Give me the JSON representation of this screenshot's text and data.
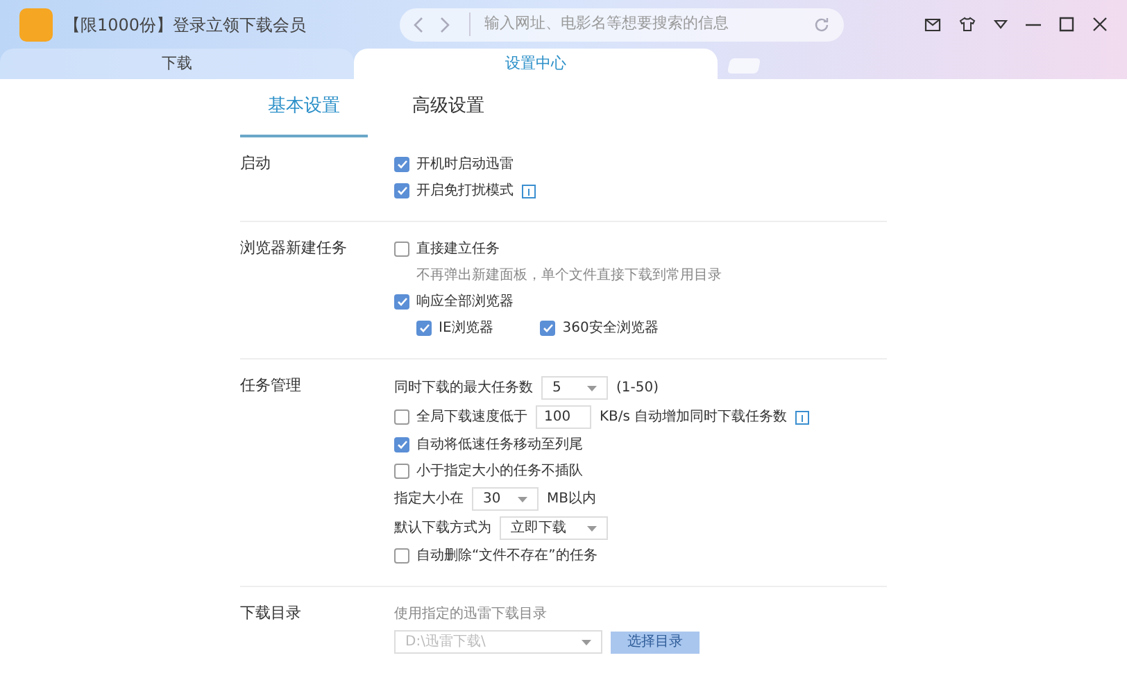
{
  "window": {
    "title": "【限1000份】登录立领下载会员",
    "search": {
      "placeholder": "输入网址、电影名等想要搜索的信息"
    }
  },
  "tabs": [
    {
      "label": "下载",
      "selected": false
    },
    {
      "label": "设置中心",
      "selected": true
    }
  ],
  "subtabs": [
    {
      "label": "基本设置",
      "selected": true
    },
    {
      "label": "高级设置",
      "selected": false
    }
  ],
  "sections": [
    {
      "title": "启动",
      "rows": [
        {
          "kind": "checkbox",
          "checked": true,
          "label": "开机时启动迅雷"
        },
        {
          "kind": "checkbox",
          "checked": true,
          "label": "开启免打扰模式",
          "info": true
        }
      ]
    },
    {
      "title": "浏览器新建任务",
      "rows": [
        {
          "kind": "checkbox",
          "checked": false,
          "label": "直接建立任务"
        },
        {
          "kind": "hint",
          "text": "不再弹出新建面板，单个文件直接下载到常用目录"
        },
        {
          "kind": "checkbox",
          "checked": true,
          "label": "响应全部浏览器"
        },
        {
          "kind": "group",
          "items": [
            {
              "checked": true,
              "label": "IE浏览器"
            },
            {
              "checked": true,
              "label": "360安全浏览器"
            }
          ]
        }
      ]
    },
    {
      "title": "任务管理",
      "rows": [
        {
          "kind": "select",
          "label": "同时下载的最大任务数",
          "value": "5",
          "suffix": "(1-50)"
        },
        {
          "kind": "checkbox_input",
          "checked": false,
          "label": "全局下载速度低于",
          "value": "100",
          "suffix": "KB/s 自动增加同时下载任务数",
          "info": true
        },
        {
          "kind": "checkbox",
          "checked": true,
          "label": "自动将低速任务移动至列尾"
        },
        {
          "kind": "checkbox",
          "checked": false,
          "label": "小于指定大小的任务不插队"
        },
        {
          "kind": "select",
          "label": "指定大小在",
          "value": "30",
          "suffix": "MB以内"
        },
        {
          "kind": "select",
          "label": "默认下载方式为",
          "value": "立即下载"
        },
        {
          "kind": "checkbox",
          "checked": false,
          "label": "自动删除“文件不存在”的任务"
        }
      ]
    },
    {
      "title": "下载目录",
      "rows": [
        {
          "kind": "hint",
          "text": "使用指定的迅雷下载目录"
        },
        {
          "kind": "path",
          "value": "D:\\迅雷下载\\",
          "button": "选择目录",
          "disabled": true
        }
      ]
    }
  ]
}
